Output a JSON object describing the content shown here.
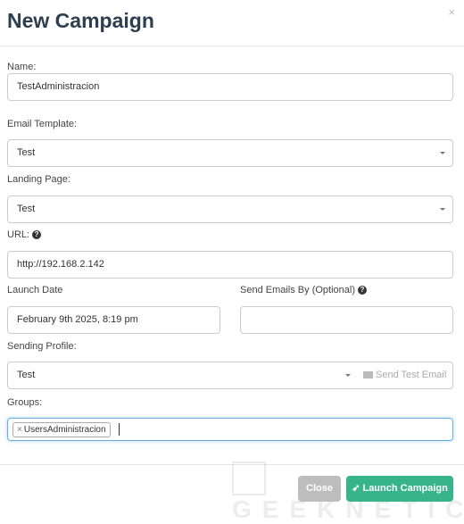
{
  "title": "New Campaign",
  "close_x": "×",
  "fields": {
    "name": {
      "label": "Name:",
      "value": "TestAdministracion"
    },
    "email_template": {
      "label": "Email Template:",
      "value": "Test"
    },
    "landing_page": {
      "label": "Landing Page:",
      "value": "Test"
    },
    "url": {
      "label": "URL:",
      "value": "http://192.168.2.142",
      "help": "?"
    },
    "launch_date": {
      "label": "Launch Date",
      "value": "February 9th 2025, 8:19 pm"
    },
    "send_by": {
      "label": "Send Emails By (Optional)",
      "value": "",
      "help": "?"
    },
    "sending_profile": {
      "label": "Sending Profile:",
      "value": "Test",
      "send_test": "Send Test Email"
    },
    "groups": {
      "label": "Groups:",
      "tags": [
        {
          "remove": "×",
          "label": "UsersAdministracion"
        }
      ]
    }
  },
  "footer": {
    "close": "Close",
    "launch": "Launch Campaign"
  },
  "watermark": "GEEKNETIC",
  "colors": {
    "primary": "#37b48a",
    "secondary": "#bdbdbd",
    "focus": "#66afe9"
  }
}
